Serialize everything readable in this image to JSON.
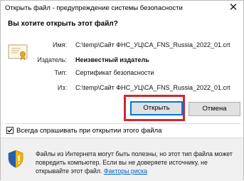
{
  "window": {
    "title": "Открыть файл - предупреждение системы безопасности"
  },
  "question": "Вы хотите открыть этот файл?",
  "fields": [
    {
      "label": "Имя:",
      "value": "C:\\temp\\Сайт ФНС_УЦ\\CA_FNS_Russia_2022_01.crt"
    },
    {
      "label": "Издатель:",
      "value": "Неизвестный издатель"
    },
    {
      "label": "Тип:",
      "value": "Сертификат безопасности"
    },
    {
      "label": "Из:",
      "value": "C:\\temp\\Сайт ФНС_УЦ\\CA_FNS_Russia_2022_01.crt"
    }
  ],
  "buttons": {
    "open": "Открыть",
    "cancel": "Отмена"
  },
  "checkbox": {
    "label": "Всегда спрашивать при открытии этого файла",
    "checked": true
  },
  "footer": {
    "warning_text": "Файлы из Интернета могут быть полезны, но этот тип файла может повредить компьютер. Если вы не доверяете источнику, не открывайте этот файл.",
    "link_text": "Факторы риска"
  },
  "colors": {
    "highlight": "#d12733",
    "default_button_border": "#0078d7",
    "link": "#0066cc"
  }
}
